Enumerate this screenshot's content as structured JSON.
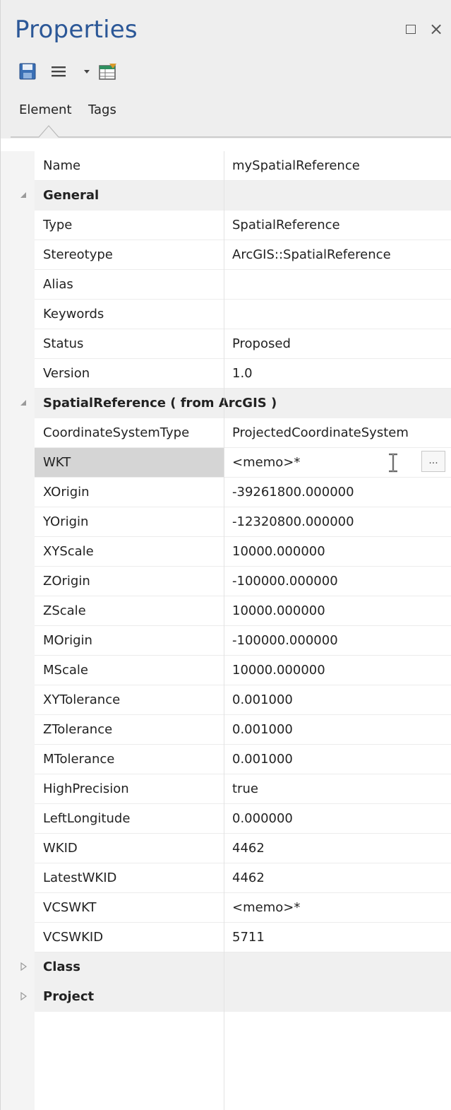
{
  "panel": {
    "title": "Properties"
  },
  "window_controls": {
    "maximize_icon": "maximize-icon",
    "close_icon": "close-icon",
    "close_glyph": "×"
  },
  "toolbar": {
    "icons": [
      "save-icon",
      "menu-icon",
      "dropdown-arrow-icon",
      "grid-icon"
    ]
  },
  "tabs": [
    {
      "label": "Element",
      "active": true
    },
    {
      "label": "Tags",
      "active": false
    }
  ],
  "properties": {
    "name_row": {
      "name": "Name",
      "value": "mySpatialReference"
    },
    "sections": [
      {
        "label": "General",
        "expanded": true,
        "rows": [
          {
            "name": "Type",
            "value": "SpatialReference"
          },
          {
            "name": "Stereotype",
            "value": "ArcGIS::SpatialReference"
          },
          {
            "name": "Alias",
            "value": ""
          },
          {
            "name": "Keywords",
            "value": ""
          },
          {
            "name": "Status",
            "value": "Proposed"
          },
          {
            "name": "Version",
            "value": "1.0"
          }
        ]
      },
      {
        "label": "SpatialReference  ( from ArcGIS )",
        "expanded": true,
        "rows": [
          {
            "name": "CoordinateSystemType",
            "value": "ProjectedCoordinateSystem"
          },
          {
            "name": "WKT",
            "value": "<memo>*",
            "selected": true,
            "ellipsis": "..."
          },
          {
            "name": "XOrigin",
            "value": "-39261800.000000"
          },
          {
            "name": "YOrigin",
            "value": "-12320800.000000"
          },
          {
            "name": "XYScale",
            "value": "10000.000000"
          },
          {
            "name": "ZOrigin",
            "value": "-100000.000000"
          },
          {
            "name": "ZScale",
            "value": "10000.000000"
          },
          {
            "name": "MOrigin",
            "value": "-100000.000000"
          },
          {
            "name": "MScale",
            "value": "10000.000000"
          },
          {
            "name": "XYTolerance",
            "value": "0.001000"
          },
          {
            "name": "ZTolerance",
            "value": "0.001000"
          },
          {
            "name": "MTolerance",
            "value": "0.001000"
          },
          {
            "name": "HighPrecision",
            "value": "true"
          },
          {
            "name": "LeftLongitude",
            "value": "0.000000"
          },
          {
            "name": "WKID",
            "value": "4462"
          },
          {
            "name": "LatestWKID",
            "value": "4462"
          },
          {
            "name": "VCSWKT",
            "value": "<memo>*"
          },
          {
            "name": "VCSWKID",
            "value": "5711"
          }
        ]
      },
      {
        "label": "Class",
        "expanded": false,
        "rows": []
      },
      {
        "label": "Project",
        "expanded": false,
        "rows": []
      }
    ]
  },
  "colors": {
    "title": "#2b5797",
    "header_bg": "#eeeeee",
    "selected_row": "#d5d5d5",
    "section_bg": "#f0f0f0"
  }
}
